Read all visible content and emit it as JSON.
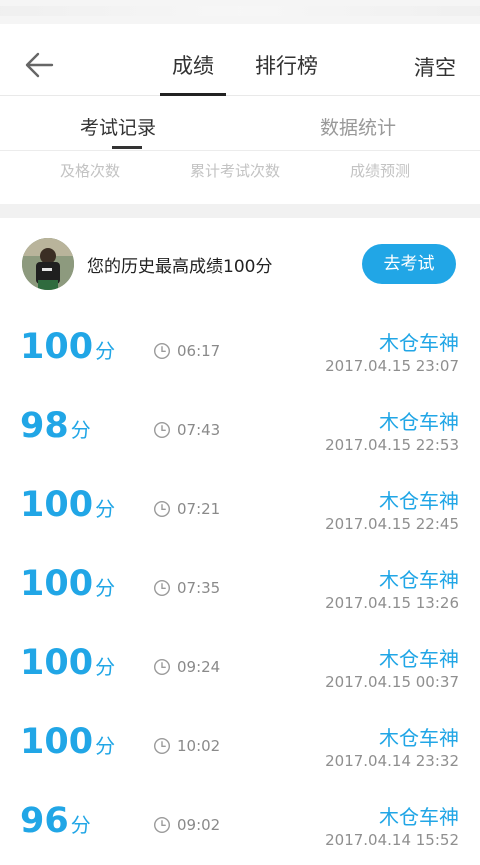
{
  "header": {
    "tabs": [
      "成绩",
      "排行榜"
    ],
    "clear_label": "清空"
  },
  "subtabs": {
    "records": "考试记录",
    "stats": "数据统计"
  },
  "stats_labels": [
    "及格次数",
    "累计考试次数",
    "成绩预测"
  ],
  "best": {
    "text": "您的历史最高成绩100分",
    "button": "去考试"
  },
  "records": [
    {
      "score": "100",
      "unit": "分",
      "duration": "06:17",
      "name": "木仓车神",
      "date": "2017.04.15  23:07"
    },
    {
      "score": "98",
      "unit": "分",
      "duration": "07:43",
      "name": "木仓车神",
      "date": "2017.04.15  22:53"
    },
    {
      "score": "100",
      "unit": "分",
      "duration": "07:21",
      "name": "木仓车神",
      "date": "2017.04.15  22:45"
    },
    {
      "score": "100",
      "unit": "分",
      "duration": "07:35",
      "name": "木仓车神",
      "date": "2017.04.15  13:26"
    },
    {
      "score": "100",
      "unit": "分",
      "duration": "09:24",
      "name": "木仓车神",
      "date": "2017.04.15  00:37"
    },
    {
      "score": "100",
      "unit": "分",
      "duration": "10:02",
      "name": "木仓车神",
      "date": "2017.04.14  23:32"
    },
    {
      "score": "96",
      "unit": "分",
      "duration": "09:02",
      "name": "木仓车神",
      "date": "2017.04.14  15:52"
    }
  ],
  "colors": {
    "accent": "#21a6e6"
  },
  "icons": {
    "back": "arrow-left-icon",
    "clock": "clock-icon"
  }
}
